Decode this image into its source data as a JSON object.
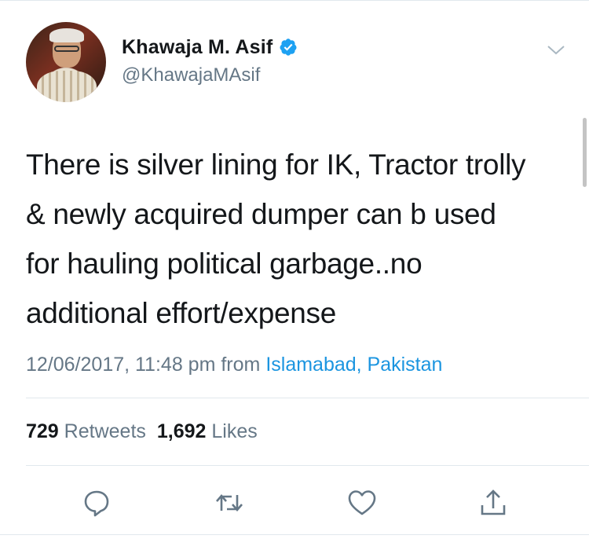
{
  "author": {
    "display_name": "Khawaja M. Asif",
    "handle": "@KhawajaMAsif",
    "verified": true
  },
  "tweet": {
    "lines": [
      "There is silver lining for IK, Tractor trolly",
      "& newly acquired dumper can b used",
      "for hauling political garbage..no",
      "additional effort/expense"
    ],
    "timestamp": "12/06/2017, 11:48 pm",
    "from_label": "from",
    "location": "Islamabad, Pakistan"
  },
  "stats": {
    "retweets_count": "729",
    "retweets_label": "Retweets",
    "likes_count": "1,692",
    "likes_label": "Likes"
  },
  "icons": {
    "verified": "verified-badge-icon",
    "menu": "chevron-down-icon",
    "reply": "reply-icon",
    "retweet": "retweet-icon",
    "like": "heart-icon",
    "share": "share-icon"
  },
  "colors": {
    "text": "#14171a",
    "secondary": "#657786",
    "link": "#1b95e0",
    "verified": "#1da1f2",
    "divider": "#e1e8ed"
  }
}
